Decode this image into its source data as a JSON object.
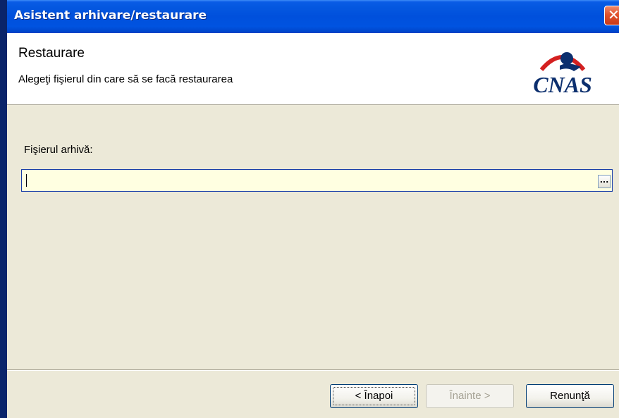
{
  "window": {
    "title": "Asistent arhivare/restaurare",
    "close_glyph": "✕"
  },
  "header": {
    "title": "Restaurare",
    "subtitle": "Alegeţi fişierul din care să se facă restaurarea",
    "logo_text": "CNAS",
    "logo_colors": {
      "text": "#0c2f6e",
      "arc": "#d42020"
    }
  },
  "form": {
    "field_label": "Fişierul arhivă:",
    "field_value": "",
    "browse_label": "..."
  },
  "buttons": {
    "back_label": "< Înapoi",
    "next_label": "Înainte >",
    "cancel_label": "Renunţă"
  }
}
